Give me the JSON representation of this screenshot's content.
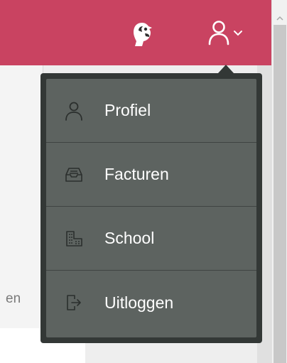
{
  "header": {
    "background": "#c94361",
    "logo_icon": "parrot-icon",
    "user_icon": "user-icon",
    "menu_chevron_icon": "chevron-down-icon"
  },
  "page": {
    "partial_text": "en"
  },
  "dropdown": {
    "background": "#333836",
    "item_background": "#5d6360",
    "items": [
      {
        "label": "Profiel",
        "icon": "user-icon"
      },
      {
        "label": "Facturen",
        "icon": "inbox-icon"
      },
      {
        "label": "School",
        "icon": "building-icon"
      },
      {
        "label": "Uitloggen",
        "icon": "logout-icon"
      }
    ]
  }
}
